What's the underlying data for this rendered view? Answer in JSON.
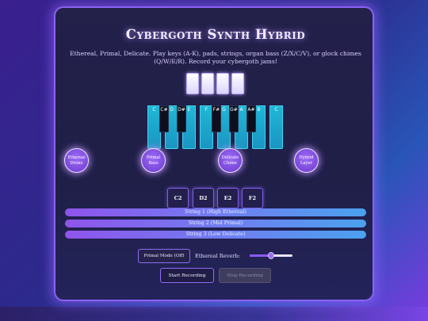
{
  "app": {
    "title": "Cybergoth Synth Hybrid",
    "subtitle": "Ethereal, Primal, Delicate. Play keys (A-K), pads, strings, organ bass (Z/X/C/V), or glock chimes (Q/W/E/R). Record your cybergoth jams!"
  },
  "chimes": [
    "chime-1",
    "chime-2",
    "chime-3",
    "chime-4"
  ],
  "piano": {
    "white_keys": [
      "C",
      "D",
      "E",
      "F",
      "G",
      "A",
      "B",
      "C"
    ],
    "black_keys": [
      "C#",
      "D#",
      "F#",
      "G#",
      "A#"
    ]
  },
  "pads": [
    {
      "label": "Ethereal Drone"
    },
    {
      "label": "Primal Bass"
    },
    {
      "label": "Delicate Chime"
    },
    {
      "label": "Hybrid Layer"
    }
  ],
  "bass_buttons": [
    "C2",
    "D2",
    "E2",
    "F2"
  ],
  "strings": [
    {
      "label": "String 1 (High Ethereal)"
    },
    {
      "label": "String 2 (Mid Primal)"
    },
    {
      "label": "String 3 (Low Delicate)"
    }
  ],
  "controls": {
    "mode_label": "Primal Mode (Off)",
    "reverb_label": "Ethereal Reverb:",
    "reverb_value": 0.5,
    "start_label": "Start Recording",
    "stop_label": "Stop Recording"
  },
  "colors": {
    "accent": "#8a62f2",
    "key_white": "#1fb7d6",
    "key_black": "#0d0f1d"
  }
}
